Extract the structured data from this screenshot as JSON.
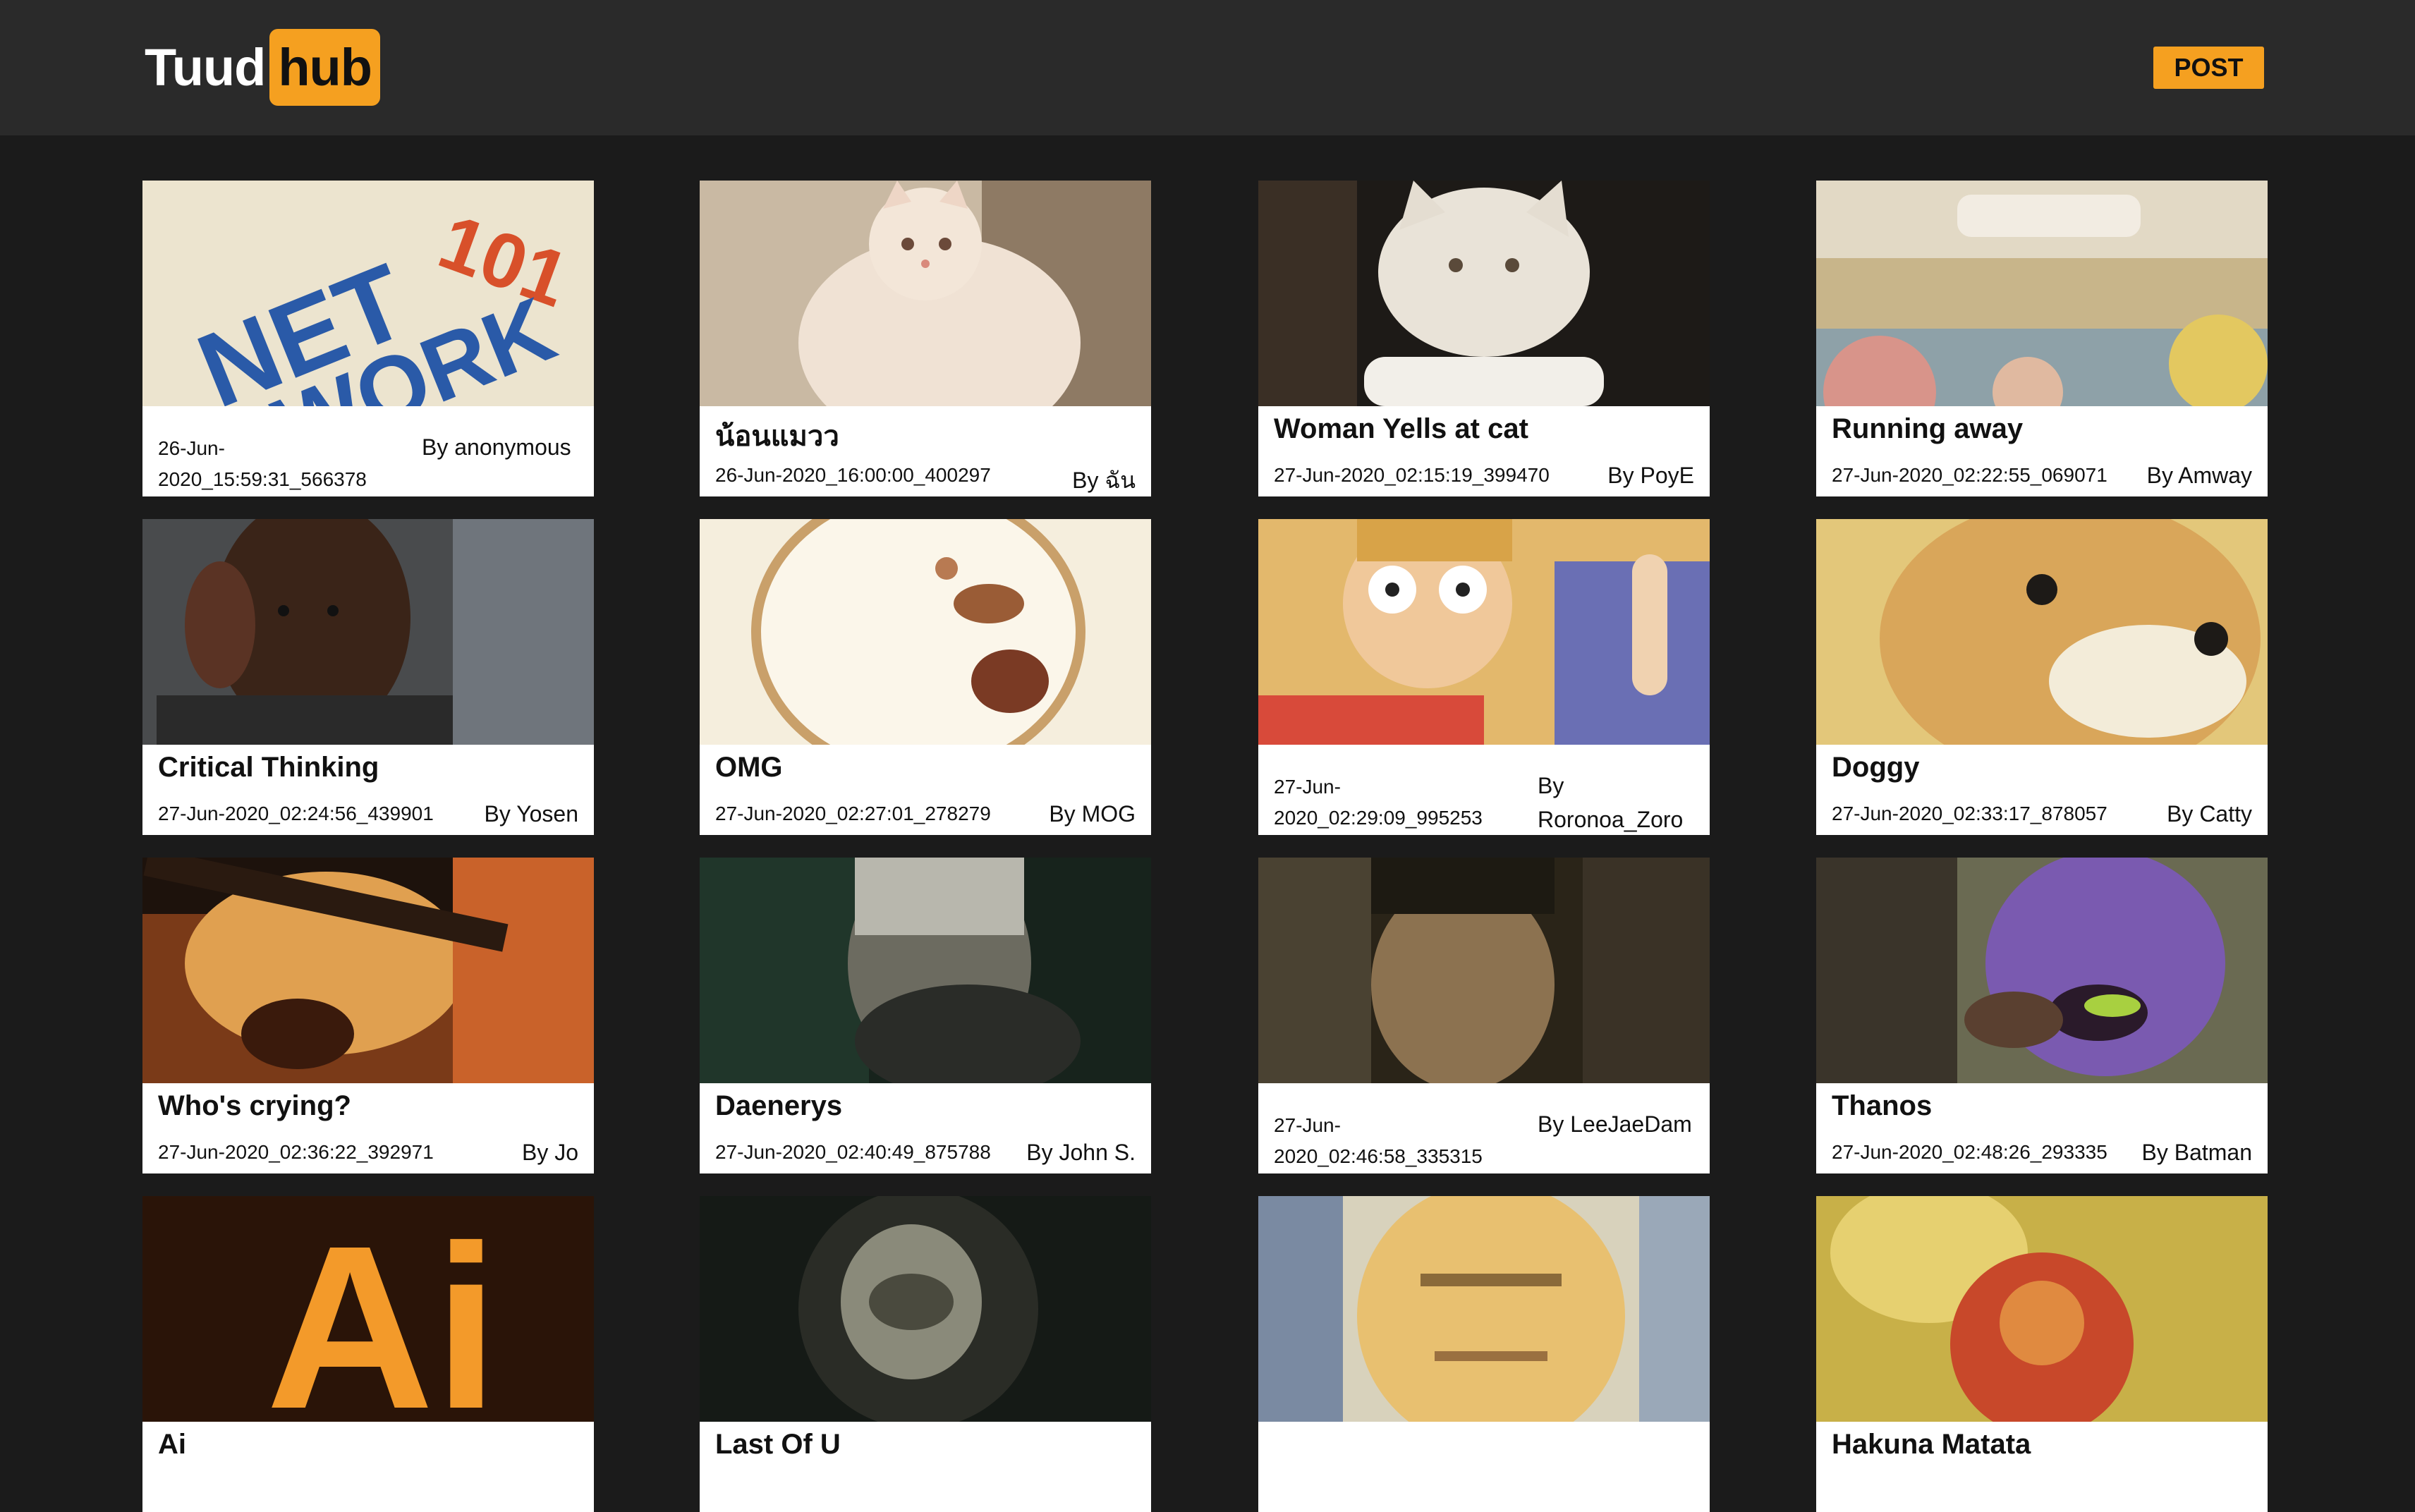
{
  "header": {
    "logo_part1": "Tuud",
    "logo_part2": "hub",
    "post_label": "POST"
  },
  "cards": [
    {
      "title": "",
      "date": "26-Jun-2020_15:59:31_566378",
      "author": "By anonymous",
      "image": "network-101-text"
    },
    {
      "title": "น้อนแมวว",
      "date": "26-Jun-2020_16:00:00_400297",
      "author": "By ฉัน",
      "image": "white-kitten"
    },
    {
      "title": "Woman Yells at cat",
      "date": "27-Jun-2020_02:15:19_399470",
      "author": "By PoyE",
      "image": "white-cat-at-table"
    },
    {
      "title": "Running away",
      "date": "27-Jun-2020_02:22:55_069071",
      "author": "By Amway",
      "image": "cartoon-characters"
    },
    {
      "title": "Critical Thinking",
      "date": "27-Jun-2020_02:24:56_439901",
      "author": "By Yosen",
      "image": "man-thinking"
    },
    {
      "title": "OMG",
      "date": "27-Jun-2020_02:27:01_278279",
      "author": "By MOG",
      "image": "rage-face"
    },
    {
      "title": "",
      "date": "27-Jun-2020_02:29:09_995253",
      "author": "By Roronoa_Zoro",
      "image": "anime-boy"
    },
    {
      "title": "Doggy",
      "date": "27-Jun-2020_02:33:17_878057",
      "author": "By Catty",
      "image": "shiba-doge"
    },
    {
      "title": "Who's crying?",
      "date": "27-Jun-2020_02:36:22_392971",
      "author": "By Jo",
      "image": "anime-crying"
    },
    {
      "title": "Daenerys",
      "date": "27-Jun-2020_02:40:49_875788",
      "author": "By John S.",
      "image": "dark-scene"
    },
    {
      "title": "",
      "date": "27-Jun-2020_02:46:58_335315",
      "author": "By LeeJaeDam",
      "image": "game-character"
    },
    {
      "title": "Thanos",
      "date": "27-Jun-2020_02:48:26_293335",
      "author": "By Batman",
      "image": "thanos-eating"
    },
    {
      "title": "Ai",
      "date": "",
      "author": "",
      "image": "adobe-ai-logo"
    },
    {
      "title": "Last Of U",
      "date": "",
      "author": "",
      "image": "dark-figure"
    },
    {
      "title": "",
      "date": "",
      "author": "",
      "image": "smiling-face"
    },
    {
      "title": "Hakuna Matata",
      "date": "",
      "author": "",
      "image": "lion-king"
    }
  ]
}
